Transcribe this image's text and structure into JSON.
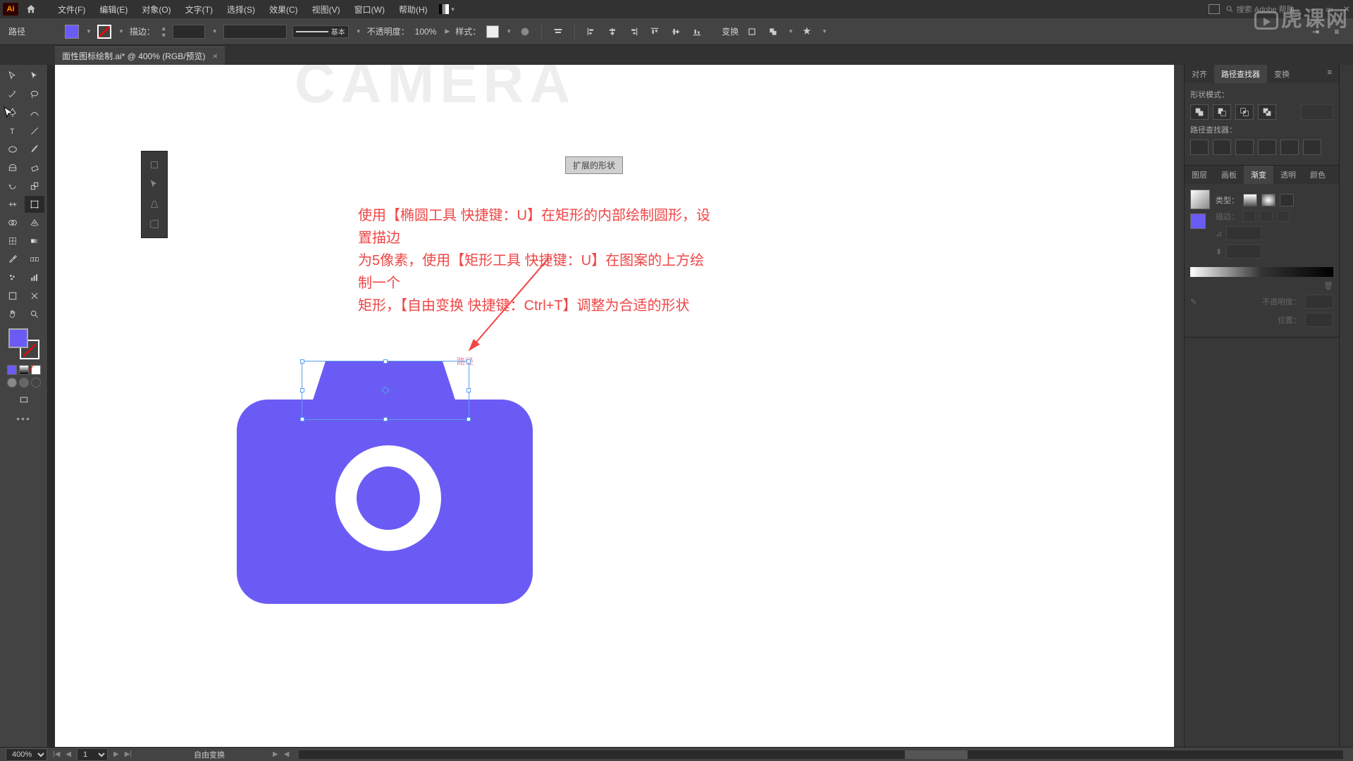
{
  "menubar": {
    "logo": "Ai",
    "items": [
      "文件(F)",
      "编辑(E)",
      "对象(O)",
      "文字(T)",
      "选择(S)",
      "效果(C)",
      "视图(V)",
      "窗口(W)",
      "帮助(H)"
    ],
    "search_placeholder": "搜索 Adobe 帮助"
  },
  "control": {
    "selection_label": "路径",
    "stroke_label": "描边：",
    "stroke_weight": "",
    "profile_label": "基本",
    "opacity_label": "不透明度：",
    "opacity_value": "100%",
    "style_label": "样式："
  },
  "doc_tab": "面性图标绘制.ai* @ 400% (RGB/预览)",
  "canvas": {
    "bg_word": "CAMERA",
    "tooltip": "扩展的形状",
    "instruction_line1": "使用【椭圆工具 快捷键：U】在矩形的内部绘制圆形，设置描边",
    "instruction_line2": "为5像素，使用【矩形工具 快捷键：U】在图案的上方绘制一个",
    "instruction_line3": "矩形，【自由变换 快捷键：Ctrl+T】调整为合适的形状",
    "path_hover": "路径"
  },
  "right": {
    "panel1_tabs": [
      "对齐",
      "路径查找器",
      "变换"
    ],
    "panel1_active": 1,
    "shape_mode_label": "形状模式：",
    "pathfinder_label": "路径查找器：",
    "panel2_tabs": [
      "图层",
      "画板",
      "渐变",
      "透明",
      "颜色"
    ],
    "panel2_active": 2,
    "type_label": "类型：",
    "stroke_label2": "描边：",
    "opacity_label2": "不透明度：",
    "position_label": "位置："
  },
  "status": {
    "zoom": "400%",
    "artboard": "1",
    "mode": "自由变换"
  },
  "watermark": "虎课网",
  "colors": {
    "accent": "#6b5bf5"
  }
}
